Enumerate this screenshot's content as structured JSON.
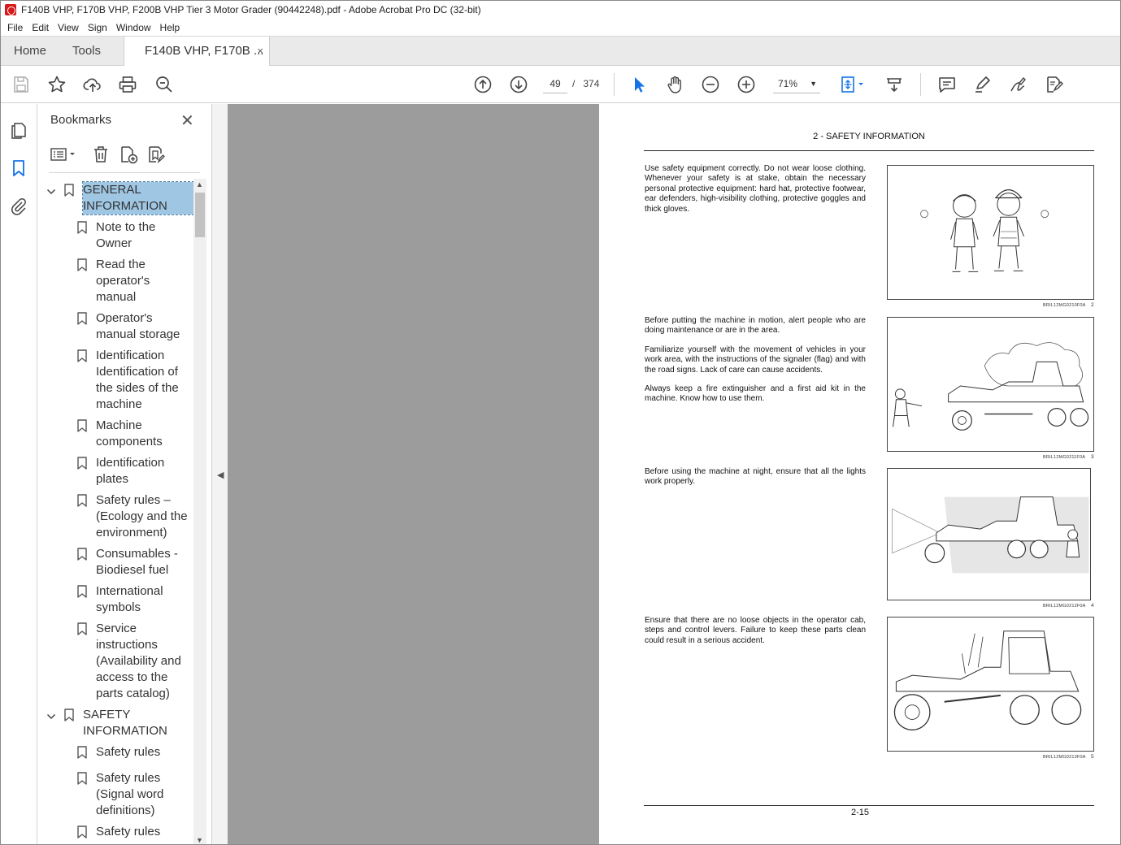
{
  "window": {
    "title": "F140B VHP, F170B VHP, F200B VHP Tier 3 Motor Grader (90442248).pdf - Adobe Acrobat Pro DC (32-bit)"
  },
  "menu": [
    "File",
    "Edit",
    "View",
    "Sign",
    "Window",
    "Help"
  ],
  "tabs": {
    "home": "Home",
    "tools": "Tools",
    "document": "F140B VHP, F170B ...",
    "close": "×"
  },
  "toolbar": {
    "current_page": "49",
    "page_separator": "/",
    "page_count": "374",
    "zoom": "71%"
  },
  "bookmarks": {
    "title": "Bookmarks",
    "items": [
      {
        "label_lines": [
          "GENERAL",
          "INFORMATION"
        ],
        "level": 0,
        "expanded": true,
        "selected": true
      },
      {
        "label_lines": [
          "Note to the",
          "Owner"
        ],
        "level": 1
      },
      {
        "label_lines": [
          "Read the",
          "operator's",
          "manual"
        ],
        "level": 1
      },
      {
        "label_lines": [
          "Operator's",
          "manual storage"
        ],
        "level": 1
      },
      {
        "label_lines": [
          "Identification",
          "Identification of",
          "the sides of the",
          "machine"
        ],
        "level": 1
      },
      {
        "label_lines": [
          "Machine",
          "components"
        ],
        "level": 1
      },
      {
        "label_lines": [
          "Identification",
          "plates"
        ],
        "level": 1
      },
      {
        "label_lines": [
          "Safety rules –",
          "(Ecology and the",
          "environment)"
        ],
        "level": 1
      },
      {
        "label_lines": [
          "Consumables -",
          "Biodiesel fuel"
        ],
        "level": 1
      },
      {
        "label_lines": [
          "International",
          "symbols"
        ],
        "level": 1
      },
      {
        "label_lines": [
          "Service",
          "instructions",
          "(Availability and",
          "access to the",
          "parts catalog)"
        ],
        "level": 1
      },
      {
        "label_lines": [
          "SAFETY",
          "INFORMATION"
        ],
        "level": 0,
        "expanded": true
      },
      {
        "label_lines": [
          "Safety rules"
        ],
        "level": 1
      },
      {
        "label_lines": [
          "Safety rules",
          "(Signal word",
          "definitions)"
        ],
        "level": 1
      },
      {
        "label_lines": [
          "Safety rules"
        ],
        "level": 1
      }
    ]
  },
  "document": {
    "header": "2 - SAFETY INFORMATION",
    "sections": [
      {
        "paragraphs": [
          "Use safety equipment correctly. Do not wear loose clothing. Whenever your safety is at stake, obtain the necessary personal protective equipment: hard hat, protective footwear, ear defenders, high-visibility clothing, protective goggles and thick gloves."
        ],
        "figure_code": "BRIL12MG0210F0A",
        "figure_number": "2"
      },
      {
        "paragraphs": [
          "Before putting the machine in motion, alert people who are doing maintenance or are in the area.",
          "Familiarize yourself with the movement of vehicles in your work area, with the instructions of the signaler (flag) and with the road signs. Lack of care can cause accidents.",
          "Always keep a fire extinguisher and a first aid kit in the machine. Know how to use them."
        ],
        "figure_code": "BRIL12MG0211F0A",
        "figure_number": "3"
      },
      {
        "paragraphs": [
          "Before using the machine at night, ensure that all the lights work properly."
        ],
        "figure_code": "BRIL12MG0212F0A",
        "figure_number": "4"
      },
      {
        "paragraphs": [
          "Ensure that there are no loose objects in the operator cab, steps and control levers. Failure to keep these parts clean could result in a serious accident."
        ],
        "figure_code": "BRIL12MG0213F0A",
        "figure_number": "5"
      }
    ],
    "page_number": "2-15"
  },
  "icons": {
    "toolbar": [
      "save-icon",
      "bookmark-star-icon",
      "upload-icon",
      "print-icon",
      "search-zoom-icon",
      "page-up-icon",
      "page-down-icon",
      "select-cursor-icon",
      "hand-icon",
      "zoom-out-icon",
      "zoom-in-icon",
      "fit-page-icon",
      "scroll-mode-icon",
      "comment-icon",
      "highlight-pen-icon",
      "sign-icon",
      "send-fill-sign-icon"
    ],
    "rail": [
      "pages-icon",
      "bookmarks-icon",
      "attachments-icon"
    ]
  },
  "colors": {
    "accent": "#1473e6",
    "selection": "#9fc6e3",
    "canvas": "#9c9c9c"
  }
}
